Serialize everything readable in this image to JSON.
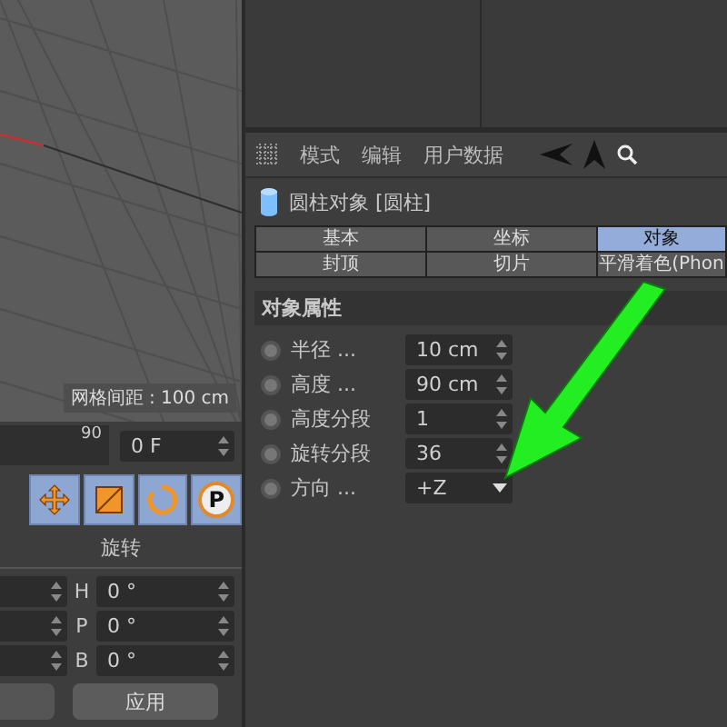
{
  "viewport": {
    "grid_spacing": "网格间距 : 100 cm"
  },
  "timeline": {
    "tick_label": "90",
    "frame": "0 F"
  },
  "tools": [
    {
      "kind": "move"
    },
    {
      "kind": "scale"
    },
    {
      "kind": "rotate"
    },
    {
      "kind": "point",
      "label": "P"
    }
  ],
  "coordinates": {
    "heading": "旋转",
    "rows": [
      {
        "axis": "H",
        "value": "0 °"
      },
      {
        "axis": "P",
        "value": "0 °"
      },
      {
        "axis": "B",
        "value": "0 °"
      }
    ],
    "apply": "应用"
  },
  "attributes": {
    "menu": [
      "模式",
      "编辑",
      "用户数据"
    ],
    "object_title": "圆柱对象 [圆柱]",
    "tabs": [
      {
        "label": "基本",
        "selected": false
      },
      {
        "label": "坐标",
        "selected": false
      },
      {
        "label": "对象",
        "selected": true
      },
      {
        "label": "封顶",
        "selected": false
      },
      {
        "label": "切片",
        "selected": false
      },
      {
        "label": "平滑着色(Phon",
        "selected": false
      }
    ],
    "section": "对象属性",
    "fields": [
      {
        "kind": "number",
        "label": "半径 ...",
        "value": "10 cm"
      },
      {
        "kind": "number",
        "label": "高度 ...",
        "value": "90 cm"
      },
      {
        "kind": "number",
        "label": "高度分段",
        "value": "1"
      },
      {
        "kind": "number",
        "label": "旋转分段",
        "value": "36"
      },
      {
        "kind": "dropdown",
        "label": "方向 ...",
        "value": "+Z"
      }
    ]
  }
}
